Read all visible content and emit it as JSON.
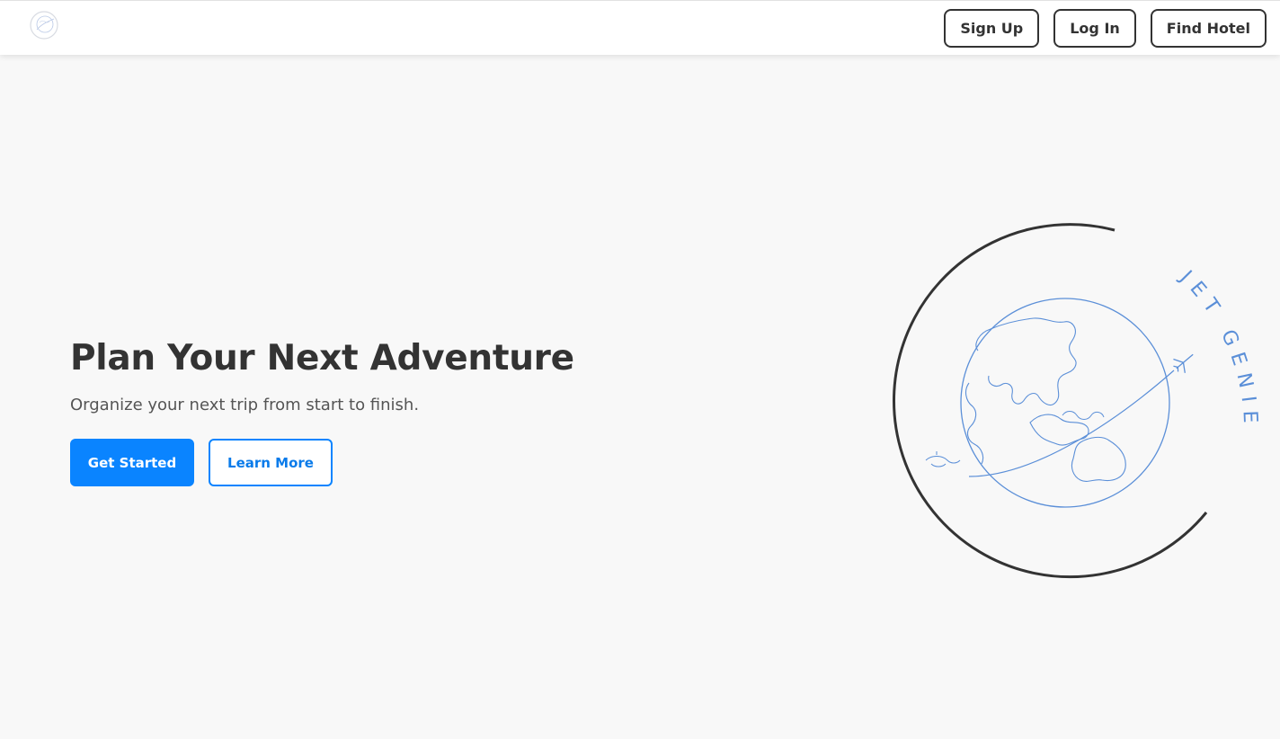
{
  "navbar": {
    "logo_icon": "jet-genie-logo-icon",
    "buttons": {
      "sign_up": "Sign Up",
      "log_in": "Log In",
      "find_hotel": "Find Hotel"
    }
  },
  "hero": {
    "title": "Plan Your Next Adventure",
    "subtitle": "Organize your next trip from start to finish.",
    "primary_button": "Get Started",
    "secondary_button": "Learn More",
    "logo_text": "JET GENIE",
    "logo_icon": "globe-airplane-icon"
  },
  "colors": {
    "background": "#f8f8f8",
    "navbar": "#ffffff",
    "text": "#333333",
    "accent": "#0a84ff",
    "logo_line": "#5b8fd8"
  }
}
